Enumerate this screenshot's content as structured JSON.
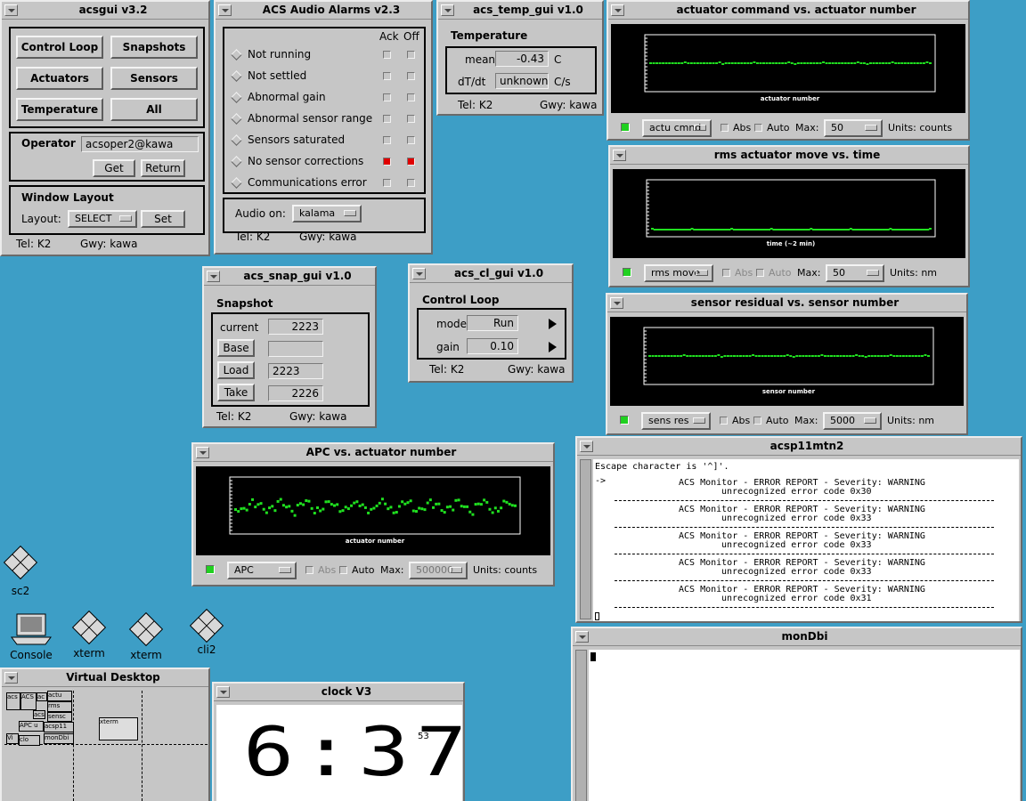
{
  "acsgui": {
    "title": "acsgui v3.2",
    "buttons": [
      "Control Loop",
      "Snapshots",
      "Actuators",
      "Sensors",
      "Temperature",
      "All"
    ],
    "operator_label": "Operator",
    "operator_value": "acsoper2@kawa",
    "get": "Get",
    "return": "Return",
    "layout_title": "Window Layout",
    "layout_label": "Layout:",
    "layout_value": "SELECT",
    "set": "Set",
    "tel": "Tel: K2",
    "gwy": "Gwy: kawa"
  },
  "alarms": {
    "title": "ACS Audio Alarms v2.3",
    "ack": "Ack",
    "off": "Off",
    "items": [
      {
        "label": "Not running",
        "ack": false,
        "off": false
      },
      {
        "label": "Not settled",
        "ack": false,
        "off": false
      },
      {
        "label": "Abnormal gain",
        "ack": false,
        "off": false
      },
      {
        "label": "Abnormal sensor range",
        "ack": false,
        "off": false
      },
      {
        "label": "Sensors saturated",
        "ack": false,
        "off": false
      },
      {
        "label": "No sensor corrections",
        "ack": true,
        "off": true
      },
      {
        "label": "Communications error",
        "ack": false,
        "off": false
      }
    ],
    "audio_label": "Audio on:",
    "audio_value": "kalama",
    "tel": "Tel: K2",
    "gwy": "Gwy: kawa"
  },
  "temp": {
    "title": "acs_temp_gui v1.0",
    "group": "Temperature",
    "mean_label": "mean",
    "mean_value": "-0.43",
    "mean_unit": "C",
    "dtdt_label": "dT/dt",
    "dtdt_value": "unknown",
    "dtdt_unit": "C/s",
    "tel": "Tel: K2",
    "gwy": "Gwy: kawa"
  },
  "snap": {
    "title": "acs_snap_gui v1.0",
    "group": "Snapshot",
    "current_label": "current",
    "current_value": "2223",
    "base_label": "Base",
    "base_value": "",
    "load_label": "Load",
    "load_value": "2223",
    "take_label": "Take",
    "take_value": "2226",
    "tel": "Tel: K2",
    "gwy": "Gwy: kawa"
  },
  "cl": {
    "title": "acs_cl_gui v1.0",
    "group": "Control Loop",
    "mode_label": "mode",
    "mode_value": "Run",
    "gain_label": "gain",
    "gain_value": "0.10",
    "tel": "Tel: K2",
    "gwy": "Gwy: kawa"
  },
  "plots": [
    {
      "title": "actuator command vs. actuator number",
      "xlabel": "actuator number",
      "sel": "actu cmnd",
      "abs": "Abs",
      "auto": "Auto",
      "max_label": "Max:",
      "max": "50",
      "units": "Units: counts",
      "dim": false
    },
    {
      "title": "rms actuator move vs. time",
      "xlabel": "time (~2 min)",
      "sel": "rms move",
      "abs": "Abs",
      "auto": "Auto",
      "max_label": "Max:",
      "max": "50",
      "units": "Units: nm",
      "dim": true
    },
    {
      "title": "sensor residual vs. sensor number",
      "xlabel": "sensor number",
      "sel": "sens res",
      "abs": "Abs",
      "auto": "Auto",
      "max_label": "Max:",
      "max": "5000",
      "units": "Units: nm",
      "dim": false
    },
    {
      "title": "APC vs. actuator number",
      "xlabel": "actuator number",
      "sel": "APC",
      "abs": "Abs",
      "auto": "Auto",
      "max_label": "Max:",
      "max": "500000",
      "units": "Units: counts",
      "dim": true
    }
  ],
  "term1": {
    "title": "acsp11mtn2",
    "escape": "Escape character is '^]'.",
    "prompt": "->",
    "report": "ACS Monitor - ERROR REPORT - Severity: WARNING",
    "codes": [
      "unrecognized error code 0x30",
      "unrecognized error code 0x33",
      "unrecognized error code 0x33",
      "unrecognized error code 0x33",
      "unrecognized error code 0x31"
    ]
  },
  "term2": {
    "title": "monDbi"
  },
  "clock": {
    "title": "clock V3",
    "time": "6:37",
    "seconds": "53"
  },
  "vdesk": {
    "title": "Virtual Desktop",
    "boxes": [
      "acs",
      "ACS",
      "ac",
      "actu",
      "rms",
      "sensc",
      "APC u",
      "acsp11",
      "acs",
      "Vi",
      "clo",
      "monDbi",
      "xterm"
    ]
  },
  "icons": {
    "sc2": "sc2",
    "console": "Console",
    "xterm1": "xterm",
    "xterm2": "xterm",
    "cli2": "cli2"
  },
  "colors": {
    "desktop": "#3d9ec6",
    "panel": "#c6c6c6",
    "trace": "#20e020"
  }
}
